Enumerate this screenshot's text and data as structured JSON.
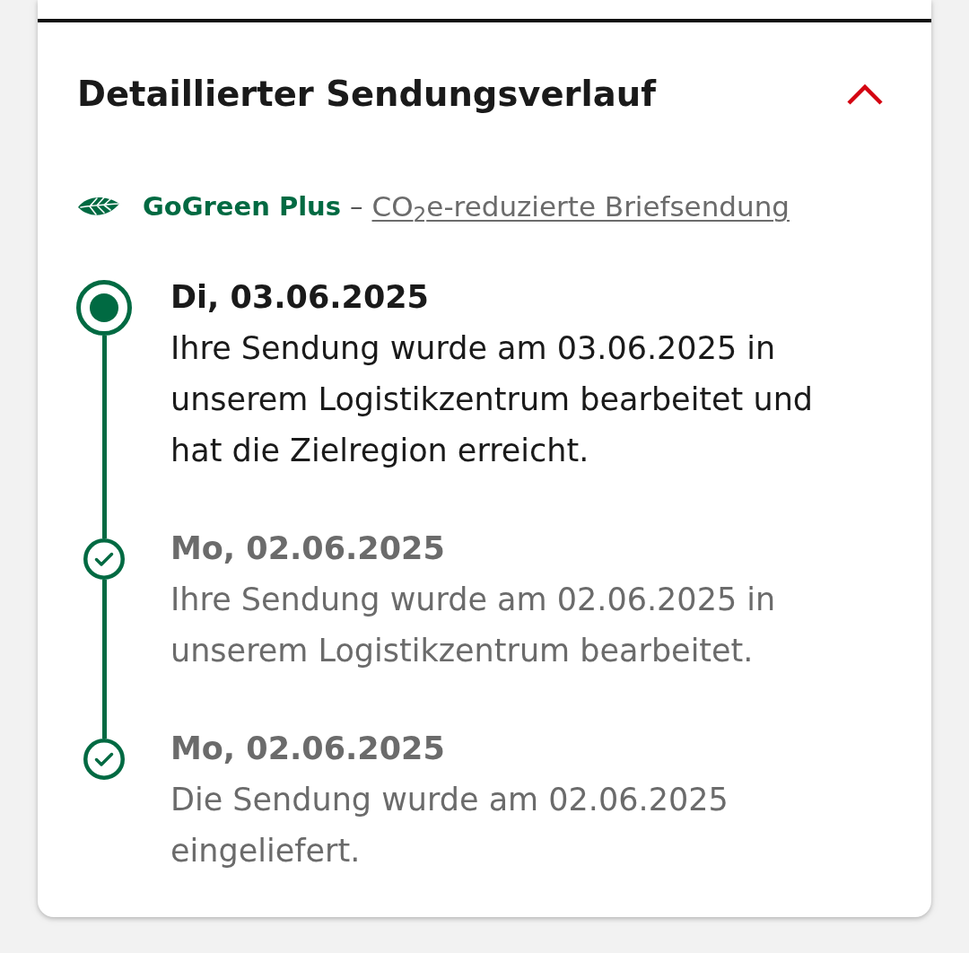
{
  "section": {
    "title": "Detaillierter Sendungsverlauf",
    "expanded": true
  },
  "product": {
    "name": "GoGreen Plus",
    "separator": "–",
    "description": "CO$_{2}$e-reduzierte Briefsendung"
  },
  "events": [
    {
      "date": "Di, 03.06.2025",
      "text": "Ihre Sendung wurde am 03.06.2025 in unserem Logistikzentrum bearbeitet und hat die Zielregion erreicht.",
      "current": true
    },
    {
      "date": "Mo, 02.06.2025",
      "text": "Ihre Sendung wurde am 02.06.2025 in unserem Logistikzentrum bearbeitet.",
      "current": false
    },
    {
      "date": "Mo, 02.06.2025",
      "text": "Die Sendung wurde am 02.06.2025 eingeliefert.",
      "current": false
    }
  ]
}
